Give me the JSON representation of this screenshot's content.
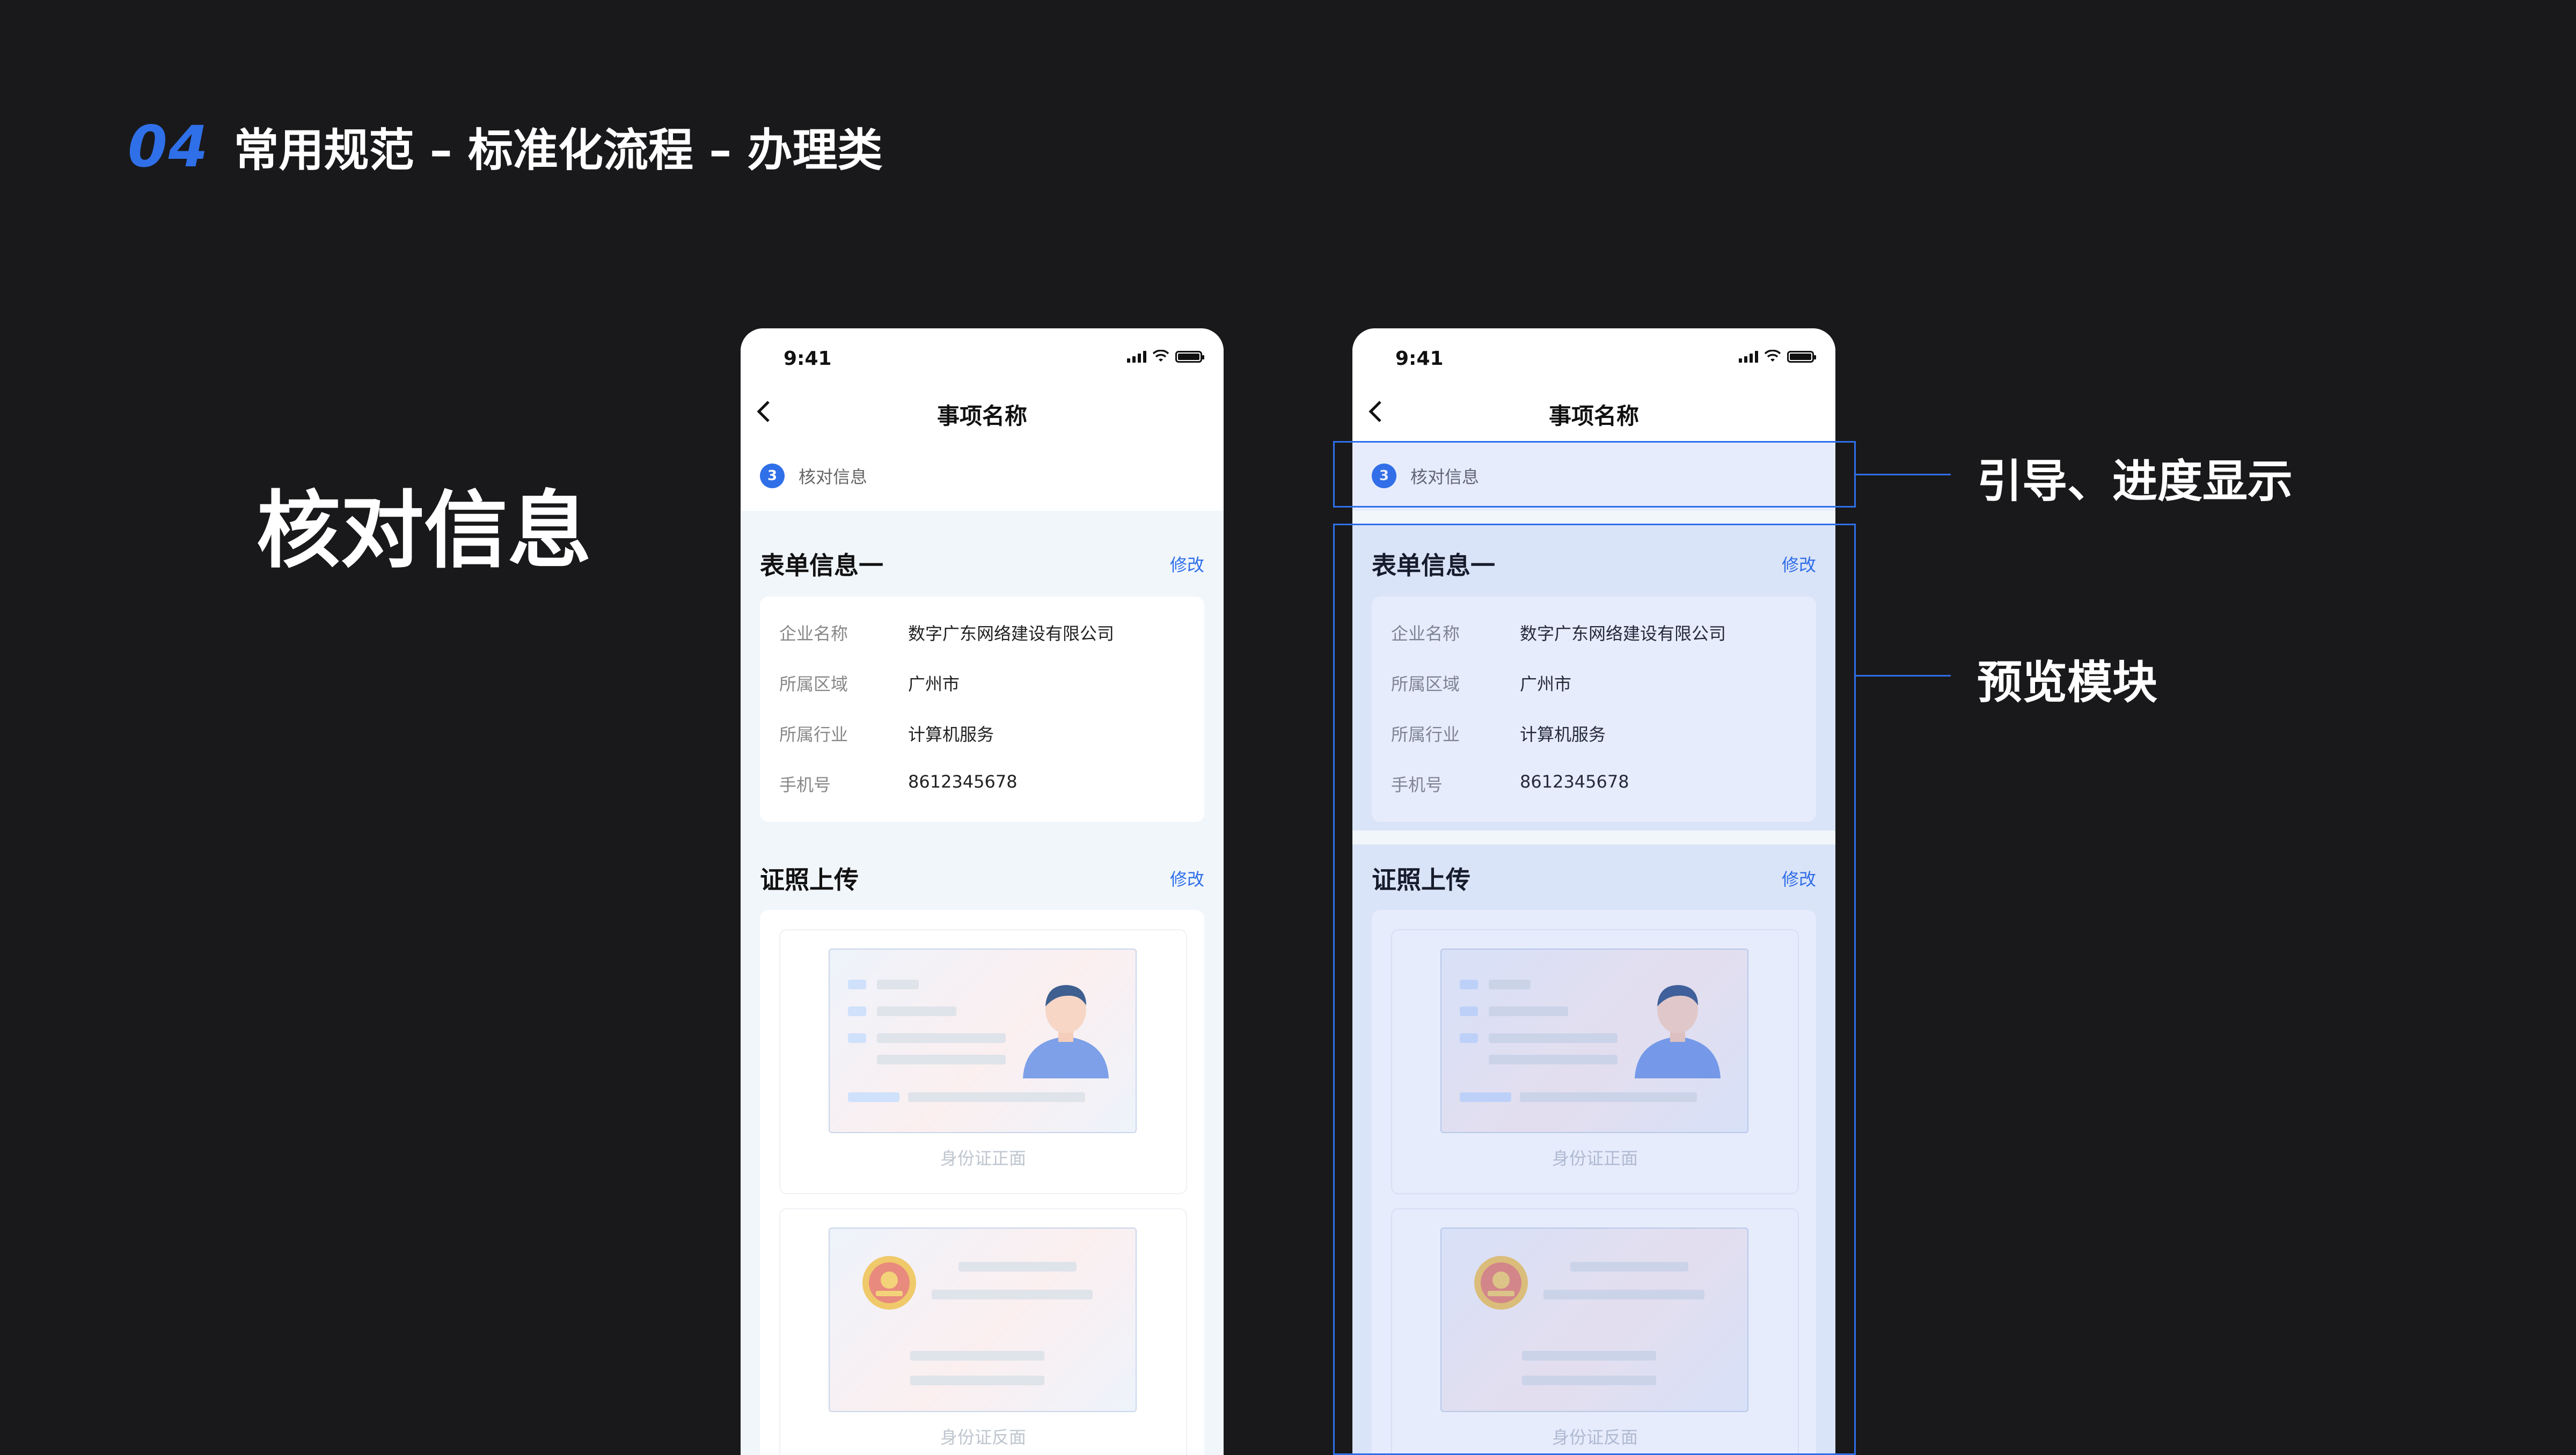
{
  "header": {
    "number": "04",
    "title": "常用规范 – 标准化流程 – 办理类"
  },
  "section_title": "核对信息",
  "phone": {
    "status_time": "9:41",
    "nav_title": "事项名称",
    "step_number": "3",
    "step_label": "核对信息",
    "form": {
      "title": "表单信息一",
      "edit": "修改",
      "rows": [
        {
          "label": "企业名称",
          "value": "数字广东网络建设有限公司"
        },
        {
          "label": "所属区域",
          "value": "广州市"
        },
        {
          "label": "所属行业",
          "value": "计算机服务"
        },
        {
          "label": "手机号",
          "value": "8612345678"
        }
      ]
    },
    "upload": {
      "title": "证照上传",
      "edit": "修改",
      "front_caption": "身份证正面",
      "back_caption": "身份证反面"
    }
  },
  "annotations": {
    "guide": "引导、进度显示",
    "preview": "预览模块"
  },
  "colors": {
    "background": "#19191b",
    "accent": "#2f6fe8",
    "overlay": "rgba(70,110,230,0.13)"
  },
  "icons": [
    "back-chevron-icon",
    "signal-icon",
    "wifi-icon",
    "battery-icon",
    "portrait-icon",
    "national-emblem-icon"
  ]
}
